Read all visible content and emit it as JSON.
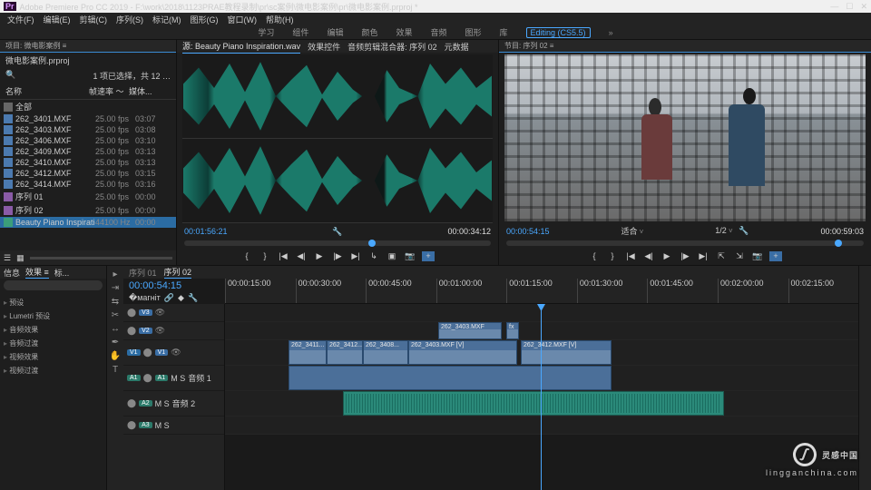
{
  "titlebar": {
    "app": "Adobe Premiere Pro CC 2019",
    "path": "F:\\work\\2018\\1123PRAE教程录制\\pr\\sc案例\\微电影案例\\pr\\微电影案例.prproj *"
  },
  "menu": [
    "文件(F)",
    "编辑(E)",
    "剪辑(C)",
    "序列(S)",
    "标记(M)",
    "图形(G)",
    "窗口(W)",
    "帮助(H)"
  ],
  "workspaces": [
    "学习",
    "组件",
    "编辑",
    "颜色",
    "效果",
    "音频",
    "图形",
    "库",
    "Editing (CS5.5)"
  ],
  "project": {
    "title": "项目: 微电影案例 ≡",
    "file": "微电影案例.prproj",
    "status": "1 项已选择，共 12 …",
    "cols": {
      "name": "名称",
      "rate": "帧速率 ～",
      "media": "媒体..."
    },
    "bin": "全部",
    "items": [
      {
        "n": "262_3401.MXF",
        "r": "25.00 fps",
        "m": "03:07"
      },
      {
        "n": "262_3403.MXF",
        "r": "25.00 fps",
        "m": "03:08"
      },
      {
        "n": "262_3406.MXF",
        "r": "25.00 fps",
        "m": "03:10"
      },
      {
        "n": "262_3409.MXF",
        "r": "25.00 fps",
        "m": "03:13"
      },
      {
        "n": "262_3410.MXF",
        "r": "25.00 fps",
        "m": "03:13"
      },
      {
        "n": "262_3412.MXF",
        "r": "25.00 fps",
        "m": "03:15"
      },
      {
        "n": "262_3414.MXF",
        "r": "25.00 fps",
        "m": "03:16"
      }
    ],
    "seq": [
      {
        "n": "序列 01",
        "r": "25.00 fps",
        "m": "00:00"
      },
      {
        "n": "序列 02",
        "r": "25.00 fps",
        "m": "00:00"
      }
    ],
    "audio": {
      "n": "Beauty Piano Inspiration.wav",
      "r": "44100 Hz",
      "m": "00:00"
    }
  },
  "source": {
    "tabs": [
      "源: Beauty Piano Inspiration.wav",
      "效果控件",
      "音频剪辑混合器: 序列 02",
      "元数据"
    ],
    "in": "00:01:56:21",
    "out": "00:00:34:12"
  },
  "program": {
    "title": "节目: 序列 02 ≡",
    "tc": "00:00:54:15",
    "fit": "适合",
    "zoom": "1/2",
    "dur": "00:00:59:03"
  },
  "fx": {
    "tabs": [
      "信息",
      "效果 ≡",
      "标..."
    ],
    "cats": [
      "预设",
      "Lumetri 预设",
      "音频效果",
      "音频过渡",
      "视频效果",
      "视频过渡"
    ]
  },
  "timeline": {
    "tabs": [
      "序列 01",
      "序列 02"
    ],
    "tc": "00:00:54:15",
    "ruler": [
      "00:00:15:00",
      "00:00:30:00",
      "00:00:45:00",
      "00:01:00:00",
      "00:01:15:00",
      "00:01:30:00",
      "00:01:45:00",
      "00:02:00:00",
      "00:02:15:00"
    ],
    "v3": {
      "label": "V3"
    },
    "v2": {
      "label": "V2"
    },
    "v1": {
      "label": "V1"
    },
    "a1": {
      "label": "A1",
      "name": "音频 1"
    },
    "a2": {
      "label": "A2",
      "name": "音频 2"
    },
    "a3": {
      "label": "A3"
    },
    "clips": {
      "v2a": "262_3403.MXF",
      "v2b": "fx",
      "v1a": "262_3411...",
      "v1b": "262_3412...",
      "v1c": "262_3408...",
      "v1d": "262_3403.MXF [V]",
      "v1e": "262_3412.MXF [V]"
    }
  },
  "watermark": {
    "txt": "灵感中国",
    "sub": "lingganchina.com"
  }
}
